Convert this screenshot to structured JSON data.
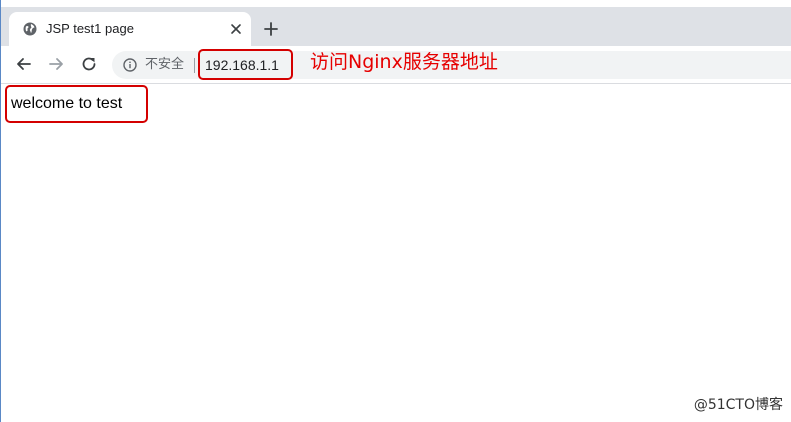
{
  "tab": {
    "title": "JSP test1 page"
  },
  "toolbar": {
    "security_label": "不安全",
    "url": "192.168.1.1"
  },
  "annotation": {
    "text": "访问Nginx服务器地址"
  },
  "page": {
    "body_text": "welcome to test"
  },
  "watermark": {
    "text": "@51CTO博客"
  },
  "colors": {
    "annotation_red": "#e60000",
    "tabstrip_bg": "#dee1e6",
    "omnibox_bg": "#f1f3f4"
  },
  "icons": {
    "tab_favicon": "globe-icon",
    "tab_close": "close-icon",
    "new_tab": "plus-icon",
    "back": "arrow-left-icon",
    "forward": "arrow-right-icon",
    "reload": "reload-icon",
    "site_info": "info-icon"
  }
}
